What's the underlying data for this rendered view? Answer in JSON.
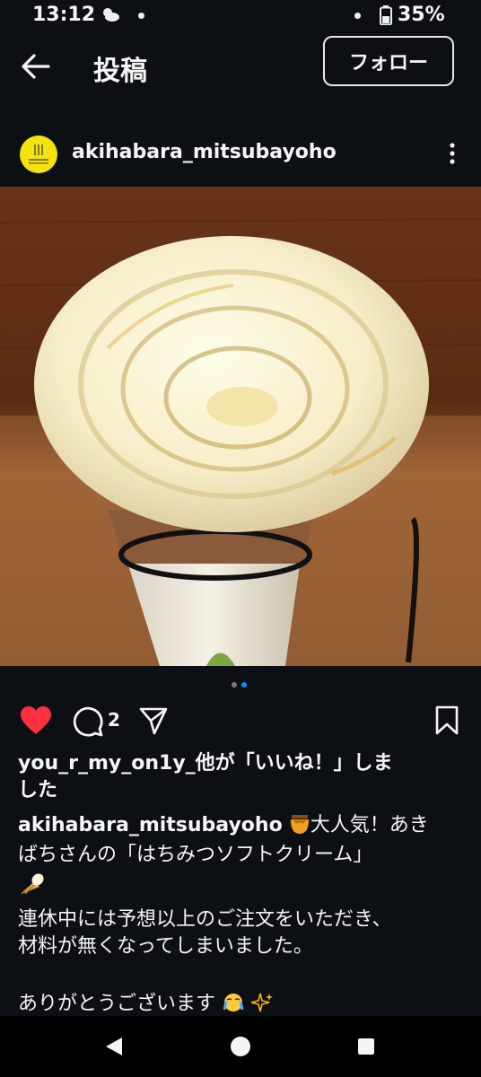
{
  "status": {
    "time": "13:12",
    "battery": "35%"
  },
  "header": {
    "title": "投稿",
    "follow_label": "フォロー"
  },
  "post": {
    "username": "akihabara_mitsubayoho",
    "comment_count": "2",
    "likes_line1": "you_r_my_on1y_他が「いいね！」しま",
    "likes_line2": "した",
    "caption_username": "akihabara_mitsubayoho",
    "caption_line1_rest": "大人気！あき",
    "caption_line2": "ばちさんの「はちみつソフトクリーム」",
    "caption_line4": "連休中には予想以上のご注文をいただき、",
    "caption_line5": "材料が無くなってしまいました。",
    "caption_line7": "ありがとうございます"
  },
  "carousel": {
    "current": 2,
    "total": 2
  },
  "icons": {
    "heart": "heart-icon",
    "comment": "comment-icon",
    "share": "share-icon",
    "bookmark": "bookmark-icon",
    "back": "back-arrow-icon",
    "more": "more-vertical-icon",
    "honey": "honey-pot-icon",
    "icecream": "ice-cream-icon",
    "cry": "crying-face-icon",
    "sparkles": "sparkles-icon"
  },
  "colors": {
    "background": "#0c1014",
    "like": "#ff3040",
    "text": "#f5f5f5",
    "dot_active": "#0095f6",
    "avatar": "#f4e20f"
  }
}
